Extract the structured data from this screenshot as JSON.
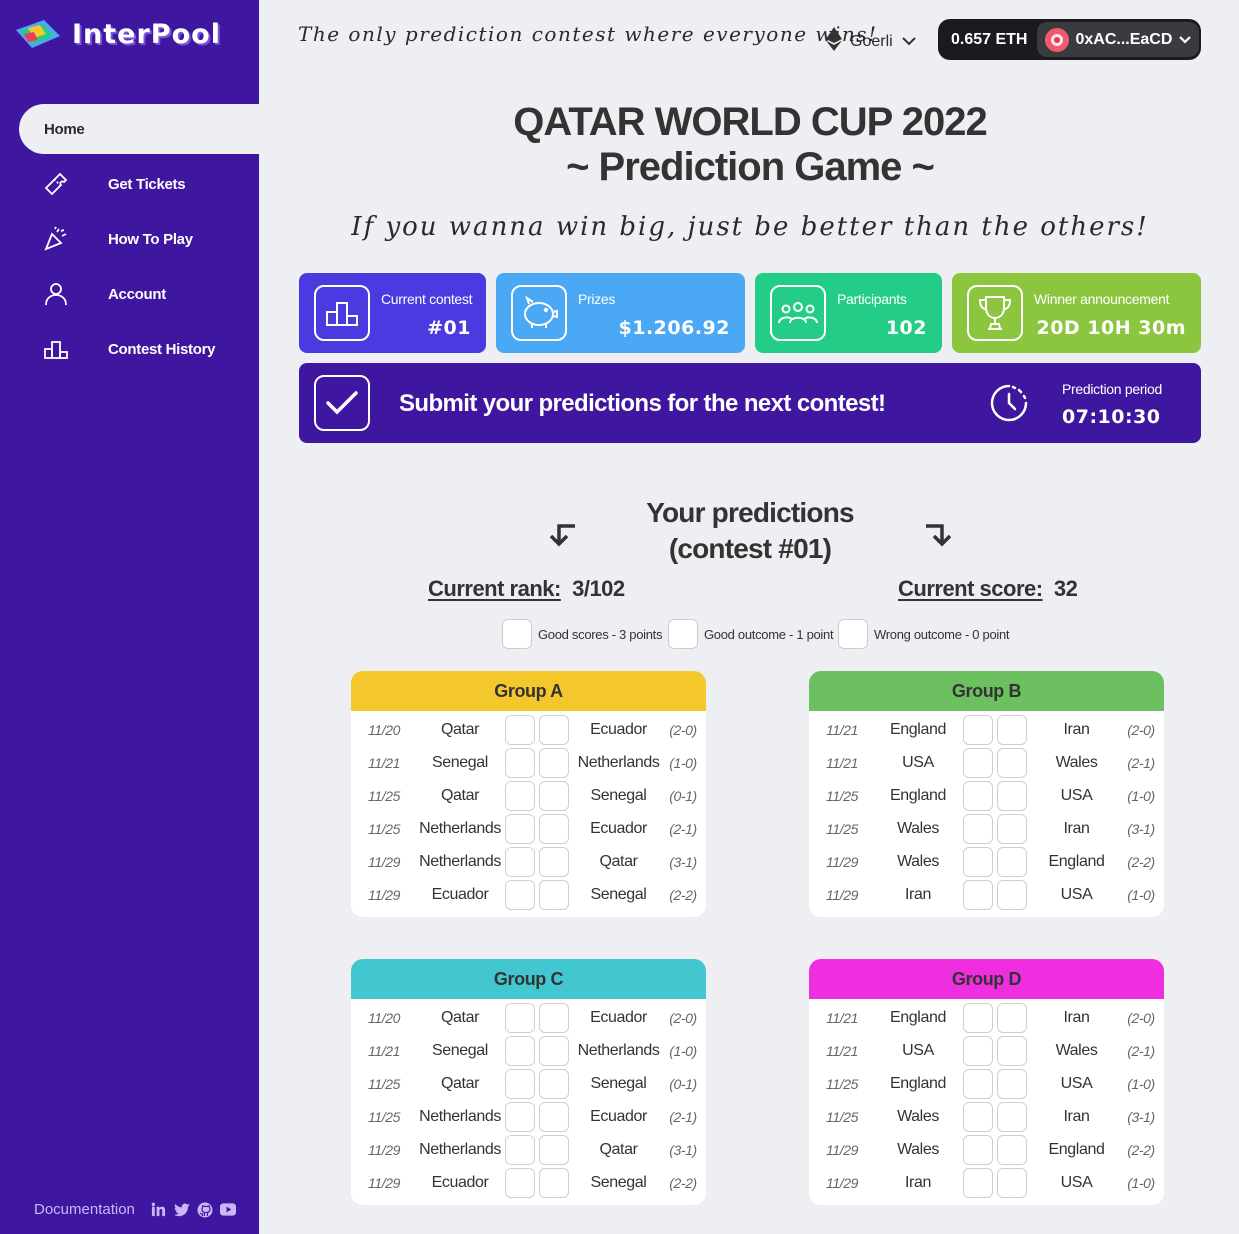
{
  "app": {
    "name": "InterPool",
    "tagline": "The only prediction contest where everyone wins!",
    "network": "Goerli",
    "balance": "0.657 ETH",
    "address": "0xAC...EaCD"
  },
  "sidebar": {
    "items": [
      {
        "label": "Home",
        "icon": "home"
      },
      {
        "label": "Get Tickets",
        "icon": "ticket-icon"
      },
      {
        "label": "How To Play",
        "icon": "party-popper-icon"
      },
      {
        "label": "Account",
        "icon": "user-icon"
      },
      {
        "label": "Contest History",
        "icon": "podium-icon"
      }
    ],
    "footer": {
      "documentation": "Documentation"
    }
  },
  "header": {
    "title_line1": "QATAR WORLD CUP 2022",
    "title_line2": "~ Prediction Game ~",
    "subtitle": "If you wanna win big, just be better than the others!"
  },
  "stats": {
    "contest_label": "Current contest",
    "contest_value": "#01",
    "prizes_label": "Prizes",
    "prizes_value": "$1.206.92",
    "participants_label": "Participants",
    "participants_value": "102",
    "winner_label": "Winner announcement",
    "winner_value": "20D 10H 30m",
    "colors": {
      "contest": "#4a3ae0",
      "prizes": "#4aa8f5",
      "participants": "#23cd88",
      "winner": "#8bc63e"
    }
  },
  "banner": {
    "message": "Submit your predictions for the next contest!",
    "period_label": "Prediction period",
    "period_value": "07:10:30"
  },
  "predictions": {
    "title_line1": "Your predictions",
    "title_line2": "(contest #01)",
    "rank_label": "Current rank:",
    "rank_value": "3/102",
    "score_label": "Current score:",
    "score_value": "32",
    "legend": [
      "Good scores - 3 points",
      "Good outcome - 1 point",
      "Wrong outcome - 0 point"
    ]
  },
  "groups": [
    {
      "name": "Group A",
      "color": "#f4c82d",
      "matches": [
        {
          "date": "11/20",
          "home": "Qatar",
          "away": "Ecuador",
          "result": "(2-0)"
        },
        {
          "date": "11/21",
          "home": "Senegal",
          "away": "Netherlands",
          "result": "(1-0)"
        },
        {
          "date": "11/25",
          "home": "Qatar",
          "away": "Senegal",
          "result": "(0-1)"
        },
        {
          "date": "11/25",
          "home": "Netherlands",
          "away": "Ecuador",
          "result": "(2-1)"
        },
        {
          "date": "11/29",
          "home": "Netherlands",
          "away": "Qatar",
          "result": "(3-1)"
        },
        {
          "date": "11/29",
          "home": "Ecuador",
          "away": "Senegal",
          "result": "(2-2)"
        }
      ]
    },
    {
      "name": "Group B",
      "color": "#6cc05f",
      "matches": [
        {
          "date": "11/21",
          "home": "England",
          "away": "Iran",
          "result": "(2-0)"
        },
        {
          "date": "11/21",
          "home": "USA",
          "away": "Wales",
          "result": "(2-1)"
        },
        {
          "date": "11/25",
          "home": "England",
          "away": "USA",
          "result": "(1-0)"
        },
        {
          "date": "11/25",
          "home": "Wales",
          "away": "Iran",
          "result": "(3-1)"
        },
        {
          "date": "11/29",
          "home": "Wales",
          "away": "England",
          "result": "(2-2)"
        },
        {
          "date": "11/29",
          "home": "Iran",
          "away": "USA",
          "result": "(1-0)"
        }
      ]
    },
    {
      "name": "Group C",
      "color": "#42c6cf",
      "matches": [
        {
          "date": "11/20",
          "home": "Qatar",
          "away": "Ecuador",
          "result": "(2-0)"
        },
        {
          "date": "11/21",
          "home": "Senegal",
          "away": "Netherlands",
          "result": "(1-0)"
        },
        {
          "date": "11/25",
          "home": "Qatar",
          "away": "Senegal",
          "result": "(0-1)"
        },
        {
          "date": "11/25",
          "home": "Netherlands",
          "away": "Ecuador",
          "result": "(2-1)"
        },
        {
          "date": "11/29",
          "home": "Netherlands",
          "away": "Qatar",
          "result": "(3-1)"
        },
        {
          "date": "11/29",
          "home": "Ecuador",
          "away": "Senegal",
          "result": "(2-2)"
        }
      ]
    },
    {
      "name": "Group D",
      "color": "#ef2ee0",
      "matches": [
        {
          "date": "11/21",
          "home": "England",
          "away": "Iran",
          "result": "(2-0)"
        },
        {
          "date": "11/21",
          "home": "USA",
          "away": "Wales",
          "result": "(2-1)"
        },
        {
          "date": "11/25",
          "home": "England",
          "away": "USA",
          "result": "(1-0)"
        },
        {
          "date": "11/25",
          "home": "Wales",
          "away": "Iran",
          "result": "(3-1)"
        },
        {
          "date": "11/29",
          "home": "Wales",
          "away": "England",
          "result": "(2-2)"
        },
        {
          "date": "11/29",
          "home": "Iran",
          "away": "USA",
          "result": "(1-0)"
        }
      ]
    }
  ]
}
